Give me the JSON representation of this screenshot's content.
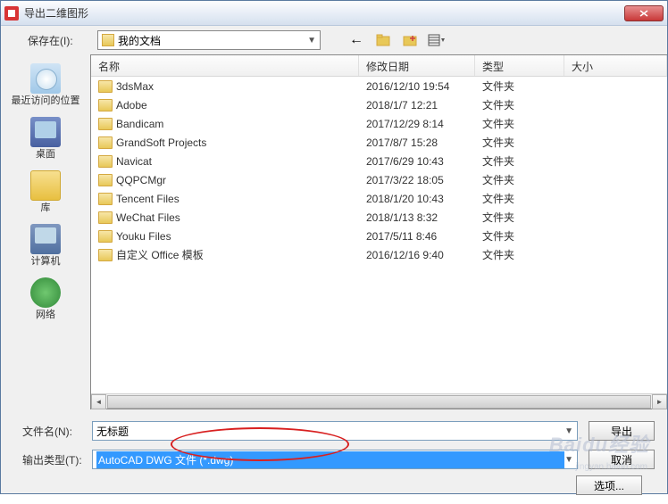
{
  "window": {
    "title": "导出二维图形"
  },
  "toolbar": {
    "save_in_label": "保存在(I):",
    "location": "我的文档"
  },
  "sidebar": {
    "items": [
      {
        "label": "最近访问的位置"
      },
      {
        "label": "桌面"
      },
      {
        "label": "库"
      },
      {
        "label": "计算机"
      },
      {
        "label": "网络"
      }
    ]
  },
  "columns": {
    "name": "名称",
    "date": "修改日期",
    "type": "类型",
    "size": "大小"
  },
  "files": [
    {
      "name": "3dsMax",
      "date": "2016/12/10 19:54",
      "type": "文件夹"
    },
    {
      "name": "Adobe",
      "date": "2018/1/7 12:21",
      "type": "文件夹"
    },
    {
      "name": "Bandicam",
      "date": "2017/12/29 8:14",
      "type": "文件夹"
    },
    {
      "name": "GrandSoft Projects",
      "date": "2017/8/7 15:28",
      "type": "文件夹"
    },
    {
      "name": "Navicat",
      "date": "2017/6/29 10:43",
      "type": "文件夹"
    },
    {
      "name": "QQPCMgr",
      "date": "2017/3/22 18:05",
      "type": "文件夹"
    },
    {
      "name": "Tencent Files",
      "date": "2018/1/20 10:43",
      "type": "文件夹"
    },
    {
      "name": "WeChat Files",
      "date": "2018/1/13 8:32",
      "type": "文件夹"
    },
    {
      "name": "Youku Files",
      "date": "2017/5/11 8:46",
      "type": "文件夹"
    },
    {
      "name": "自定义 Office 模板",
      "date": "2016/12/16 9:40",
      "type": "文件夹"
    }
  ],
  "bottom": {
    "filename_label": "文件名(N):",
    "filename_value": "无标题",
    "filetype_label": "输出类型(T):",
    "filetype_value": "AutoCAD DWG 文件 (*.dwg)",
    "export_btn": "导出",
    "cancel_btn": "取消",
    "options_btn": "选项..."
  },
  "watermark": {
    "main": "Baidu经验",
    "sub": "jingyan.baidu.com"
  }
}
